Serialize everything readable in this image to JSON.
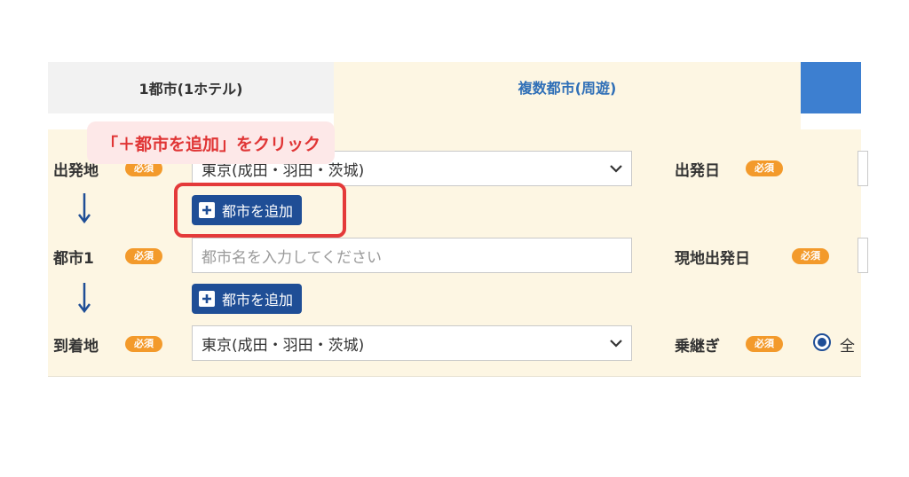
{
  "tabs": [
    {
      "label": "1都市(1ホテル)"
    },
    {
      "label": "複数都市(周遊)"
    }
  ],
  "required_badge": "必須",
  "callout": "「＋都市を追加」をクリック",
  "form": {
    "departure": {
      "label": "出発地",
      "value": "東京(成田・羽田・茨城)"
    },
    "add_city_label": "都市を追加",
    "city1": {
      "label": "都市1",
      "placeholder": "都市名を入力してください"
    },
    "arrival": {
      "label": "到着地",
      "value": "東京(成田・羽田・茨城)"
    },
    "departure_date": {
      "label": "出発日"
    },
    "local_departure_date": {
      "label": "現地出発日"
    },
    "transfer": {
      "label": "乗継ぎ",
      "option_label": "全"
    }
  },
  "colors": {
    "accent_blue": "#1f4e96",
    "required_orange": "#f39a2b",
    "highlight_red": "#e43a3a",
    "panel_bg": "#fdf6e3"
  }
}
